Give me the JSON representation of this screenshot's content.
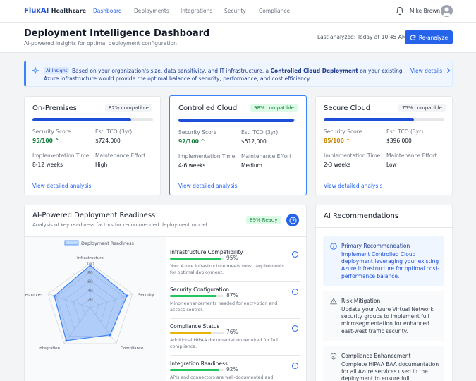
{
  "brand": {
    "name1": "FluxAI",
    "name2": "Healthcare"
  },
  "nav": {
    "items": [
      "Dashboard",
      "Deployments",
      "Integrations",
      "Security",
      "Compliance"
    ],
    "active": "Dashboard"
  },
  "user": {
    "name": "Mike Brown"
  },
  "header": {
    "title": "Deployment Intelligence Dashboard",
    "subtitle": "AI-powered insights for optimal deployment configuration",
    "last_analyzed": "Last analyzed: Today at 10:45 AM",
    "reanalyze": "Re-analyze"
  },
  "insight": {
    "tag": "AI Insight",
    "text_before": "Based on your organization's size, data sensitivity, and IT infrastructure, a ",
    "highlight": "Controlled Cloud Deployment",
    "text_after": " on your existing Azure infrastructure would provide the optimal balance of security, performance, and cost efficiency.",
    "link": "View details"
  },
  "labels": {
    "security_score": "Security Score",
    "tco": "Est. TCO (3yr)",
    "impl": "Implementation Time",
    "maint": "Maintenance Effort",
    "link": "View detailed analysis"
  },
  "options": [
    {
      "title": "On-Premises",
      "compat": "82% compatible",
      "pct": 82,
      "score": "95/100",
      "score_color": "#15803d",
      "trend": "^",
      "tco": "$724,000",
      "impl": "8-12 weeks",
      "maint": "High"
    },
    {
      "title": "Controlled Cloud",
      "compat": "98% compatible",
      "pct": 98,
      "score": "92/100",
      "score_color": "#15803d",
      "trend": "^",
      "tco": "$512,000",
      "impl": "4-6 weeks",
      "maint": "Medium"
    },
    {
      "title": "Secure Cloud",
      "compat": "75% compatible",
      "pct": 75,
      "score": "85/100",
      "score_color": "#ca8a04",
      "trend": "↑",
      "tco": "$396,000",
      "impl": "2-3 weeks",
      "maint": "Low"
    }
  ],
  "readiness": {
    "title": "AI-Powered Deployment Readiness",
    "subtitle": "Analysis of key readiness factors for recommended deployment model",
    "badge": "89% Ready",
    "chart_data": {
      "type": "radar",
      "legend": "Deployment Readiness",
      "axes": [
        "Infrastructure",
        "Security",
        "Compliance",
        "Integration",
        "Resources"
      ],
      "ticks": [
        "100",
        "80",
        "60",
        "40",
        "20"
      ],
      "rmax": 100,
      "values": [
        95,
        87,
        76,
        92,
        85
      ]
    },
    "factors": [
      {
        "title": "Infrastructure Compatibility",
        "pct": 95,
        "pct_label": "95%",
        "color": "#22c55e",
        "desc": "Your Azure infrastructure meets most requirements for optimal deployment."
      },
      {
        "title": "Security Configuration",
        "pct": 87,
        "pct_label": "87%",
        "color": "#22c55e",
        "desc": "Minor enhancements needed for encryption and access control."
      },
      {
        "title": "Compliance Status",
        "pct": 76,
        "pct_label": "76%",
        "color": "#eab308",
        "desc": "Additional HIPAA documentation required for full compliance."
      },
      {
        "title": "Integration Readiness",
        "pct": 92,
        "pct_label": "92%",
        "color": "#22c55e",
        "desc": "APIs and connectors are well-documented and compatible."
      }
    ]
  },
  "recommendations": {
    "title": "AI Recommendations",
    "items": [
      {
        "title": "Primary Recommendation",
        "desc": "Implement Controlled Cloud deployment leveraging your existing Azure infrastructure for optimal cost-performance balance.",
        "icon": "info-icon"
      },
      {
        "title": "Risk Mitigation",
        "desc": "Update your Azure Virtual Network security groups to implement full microsegmentation for enhanced east-west traffic security.",
        "icon": "warning-icon"
      },
      {
        "title": "Compliance Enhancement",
        "desc": "Complete HIPAA BAA documentation for all Azure services used in the deployment to ensure full compliance.",
        "icon": "shield-icon"
      }
    ]
  }
}
